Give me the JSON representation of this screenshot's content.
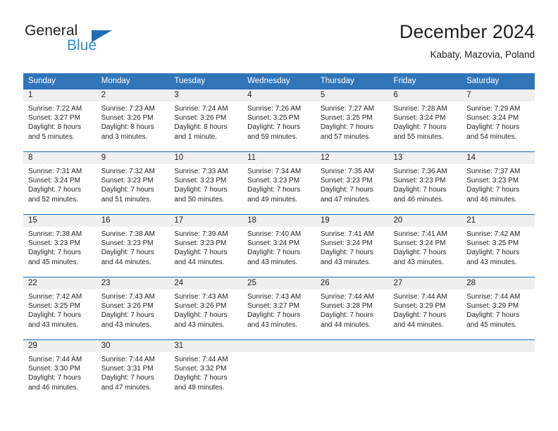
{
  "brand": {
    "name_top": "General",
    "name_bottom": "Blue",
    "triangle_color": "#1f6db5",
    "blue_text_color": "#2e8bd4"
  },
  "header": {
    "title": "December 2024",
    "subtitle": "Kabaty, Mazovia, Poland"
  },
  "theme": {
    "header_blue": "#3175b8",
    "row_divider_blue": "#1f6db5",
    "daynum_band_gray": "#efefef",
    "text_color": "#231f20"
  },
  "weekday_headers": [
    "Sunday",
    "Monday",
    "Tuesday",
    "Wednesday",
    "Thursday",
    "Friday",
    "Saturday"
  ],
  "weeks": [
    [
      {
        "day": "1",
        "sunrise": "Sunrise: 7:22 AM",
        "sunset": "Sunset: 3:27 PM",
        "daylight_1": "Daylight: 8 hours",
        "daylight_2": "and 5 minutes."
      },
      {
        "day": "2",
        "sunrise": "Sunrise: 7:23 AM",
        "sunset": "Sunset: 3:26 PM",
        "daylight_1": "Daylight: 8 hours",
        "daylight_2": "and 3 minutes."
      },
      {
        "day": "3",
        "sunrise": "Sunrise: 7:24 AM",
        "sunset": "Sunset: 3:26 PM",
        "daylight_1": "Daylight: 8 hours",
        "daylight_2": "and 1 minute."
      },
      {
        "day": "4",
        "sunrise": "Sunrise: 7:26 AM",
        "sunset": "Sunset: 3:25 PM",
        "daylight_1": "Daylight: 7 hours",
        "daylight_2": "and 59 minutes."
      },
      {
        "day": "5",
        "sunrise": "Sunrise: 7:27 AM",
        "sunset": "Sunset: 3:25 PM",
        "daylight_1": "Daylight: 7 hours",
        "daylight_2": "and 57 minutes."
      },
      {
        "day": "6",
        "sunrise": "Sunrise: 7:28 AM",
        "sunset": "Sunset: 3:24 PM",
        "daylight_1": "Daylight: 7 hours",
        "daylight_2": "and 55 minutes."
      },
      {
        "day": "7",
        "sunrise": "Sunrise: 7:29 AM",
        "sunset": "Sunset: 3:24 PM",
        "daylight_1": "Daylight: 7 hours",
        "daylight_2": "and 54 minutes."
      }
    ],
    [
      {
        "day": "8",
        "sunrise": "Sunrise: 7:31 AM",
        "sunset": "Sunset: 3:24 PM",
        "daylight_1": "Daylight: 7 hours",
        "daylight_2": "and 52 minutes."
      },
      {
        "day": "9",
        "sunrise": "Sunrise: 7:32 AM",
        "sunset": "Sunset: 3:23 PM",
        "daylight_1": "Daylight: 7 hours",
        "daylight_2": "and 51 minutes."
      },
      {
        "day": "10",
        "sunrise": "Sunrise: 7:33 AM",
        "sunset": "Sunset: 3:23 PM",
        "daylight_1": "Daylight: 7 hours",
        "daylight_2": "and 50 minutes."
      },
      {
        "day": "11",
        "sunrise": "Sunrise: 7:34 AM",
        "sunset": "Sunset: 3:23 PM",
        "daylight_1": "Daylight: 7 hours",
        "daylight_2": "and 49 minutes."
      },
      {
        "day": "12",
        "sunrise": "Sunrise: 7:35 AM",
        "sunset": "Sunset: 3:23 PM",
        "daylight_1": "Daylight: 7 hours",
        "daylight_2": "and 47 minutes."
      },
      {
        "day": "13",
        "sunrise": "Sunrise: 7:36 AM",
        "sunset": "Sunset: 3:23 PM",
        "daylight_1": "Daylight: 7 hours",
        "daylight_2": "and 46 minutes."
      },
      {
        "day": "14",
        "sunrise": "Sunrise: 7:37 AM",
        "sunset": "Sunset: 3:23 PM",
        "daylight_1": "Daylight: 7 hours",
        "daylight_2": "and 46 minutes."
      }
    ],
    [
      {
        "day": "15",
        "sunrise": "Sunrise: 7:38 AM",
        "sunset": "Sunset: 3:23 PM",
        "daylight_1": "Daylight: 7 hours",
        "daylight_2": "and 45 minutes."
      },
      {
        "day": "16",
        "sunrise": "Sunrise: 7:38 AM",
        "sunset": "Sunset: 3:23 PM",
        "daylight_1": "Daylight: 7 hours",
        "daylight_2": "and 44 minutes."
      },
      {
        "day": "17",
        "sunrise": "Sunrise: 7:39 AM",
        "sunset": "Sunset: 3:23 PM",
        "daylight_1": "Daylight: 7 hours",
        "daylight_2": "and 44 minutes."
      },
      {
        "day": "18",
        "sunrise": "Sunrise: 7:40 AM",
        "sunset": "Sunset: 3:24 PM",
        "daylight_1": "Daylight: 7 hours",
        "daylight_2": "and 43 minutes."
      },
      {
        "day": "19",
        "sunrise": "Sunrise: 7:41 AM",
        "sunset": "Sunset: 3:24 PM",
        "daylight_1": "Daylight: 7 hours",
        "daylight_2": "and 43 minutes."
      },
      {
        "day": "20",
        "sunrise": "Sunrise: 7:41 AM",
        "sunset": "Sunset: 3:24 PM",
        "daylight_1": "Daylight: 7 hours",
        "daylight_2": "and 43 minutes."
      },
      {
        "day": "21",
        "sunrise": "Sunrise: 7:42 AM",
        "sunset": "Sunset: 3:25 PM",
        "daylight_1": "Daylight: 7 hours",
        "daylight_2": "and 43 minutes."
      }
    ],
    [
      {
        "day": "22",
        "sunrise": "Sunrise: 7:42 AM",
        "sunset": "Sunset: 3:25 PM",
        "daylight_1": "Daylight: 7 hours",
        "daylight_2": "and 43 minutes."
      },
      {
        "day": "23",
        "sunrise": "Sunrise: 7:43 AM",
        "sunset": "Sunset: 3:26 PM",
        "daylight_1": "Daylight: 7 hours",
        "daylight_2": "and 43 minutes."
      },
      {
        "day": "24",
        "sunrise": "Sunrise: 7:43 AM",
        "sunset": "Sunset: 3:26 PM",
        "daylight_1": "Daylight: 7 hours",
        "daylight_2": "and 43 minutes."
      },
      {
        "day": "25",
        "sunrise": "Sunrise: 7:43 AM",
        "sunset": "Sunset: 3:27 PM",
        "daylight_1": "Daylight: 7 hours",
        "daylight_2": "and 43 minutes."
      },
      {
        "day": "26",
        "sunrise": "Sunrise: 7:44 AM",
        "sunset": "Sunset: 3:28 PM",
        "daylight_1": "Daylight: 7 hours",
        "daylight_2": "and 44 minutes."
      },
      {
        "day": "27",
        "sunrise": "Sunrise: 7:44 AM",
        "sunset": "Sunset: 3:29 PM",
        "daylight_1": "Daylight: 7 hours",
        "daylight_2": "and 44 minutes."
      },
      {
        "day": "28",
        "sunrise": "Sunrise: 7:44 AM",
        "sunset": "Sunset: 3:29 PM",
        "daylight_1": "Daylight: 7 hours",
        "daylight_2": "and 45 minutes."
      }
    ],
    [
      {
        "day": "29",
        "sunrise": "Sunrise: 7:44 AM",
        "sunset": "Sunset: 3:30 PM",
        "daylight_1": "Daylight: 7 hours",
        "daylight_2": "and 46 minutes."
      },
      {
        "day": "30",
        "sunrise": "Sunrise: 7:44 AM",
        "sunset": "Sunset: 3:31 PM",
        "daylight_1": "Daylight: 7 hours",
        "daylight_2": "and 47 minutes."
      },
      {
        "day": "31",
        "sunrise": "Sunrise: 7:44 AM",
        "sunset": "Sunset: 3:32 PM",
        "daylight_1": "Daylight: 7 hours",
        "daylight_2": "and 48 minutes."
      },
      {
        "day": "",
        "sunrise": "",
        "sunset": "",
        "daylight_1": "",
        "daylight_2": ""
      },
      {
        "day": "",
        "sunrise": "",
        "sunset": "",
        "daylight_1": "",
        "daylight_2": ""
      },
      {
        "day": "",
        "sunrise": "",
        "sunset": "",
        "daylight_1": "",
        "daylight_2": ""
      },
      {
        "day": "",
        "sunrise": "",
        "sunset": "",
        "daylight_1": "",
        "daylight_2": ""
      }
    ]
  ]
}
